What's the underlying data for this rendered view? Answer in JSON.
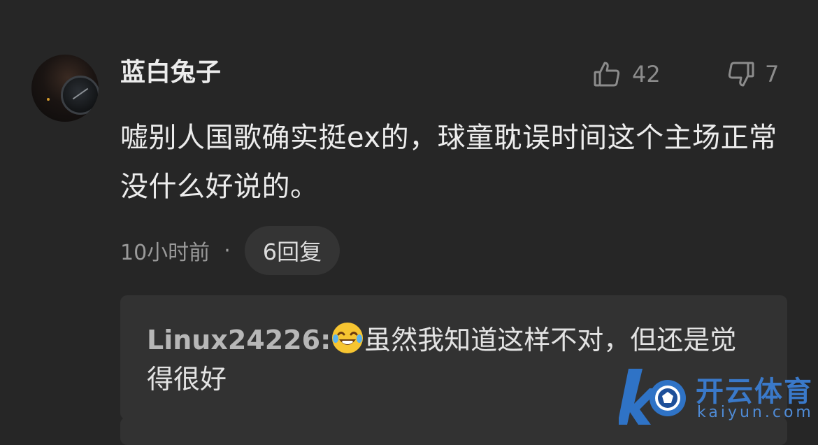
{
  "comment": {
    "username": "蓝白兔子",
    "likes": "42",
    "dislikes": "7",
    "text": "嘘别人国歌确实挺ex的，球童耽误时间这个主场正常没什么好说的。",
    "time": "10小时前",
    "separator": "·",
    "reply_button": "6回复"
  },
  "reply": {
    "author": "Linux24226",
    "colon": ":",
    "emoji": "laughing-with-tears-emoji",
    "text": "虽然我知道这样不对，但还是觉得很好"
  },
  "watermark": {
    "cn": "开云体育",
    "en": "kaiyun.com"
  },
  "colors": {
    "background": "#262626",
    "reply_background": "#323232",
    "watermark_blue": "#3a79c9"
  }
}
